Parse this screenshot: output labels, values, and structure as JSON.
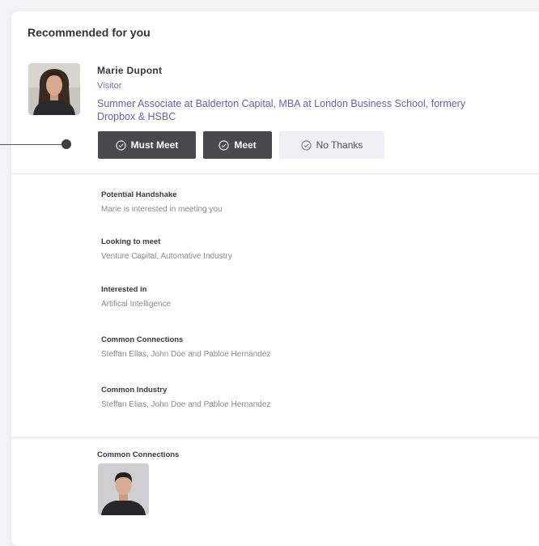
{
  "section": {
    "title": "Recommended for you"
  },
  "person": {
    "name": "Marie Dupont",
    "role": "Visitor",
    "headline": "Summer Associate at Balderton Capital, MBA at London Business School, formery Dropbox & HSBC"
  },
  "actions": {
    "must_meet_label": "Must Meet",
    "meet_label": "Meet",
    "no_thanks_label": "No Thanks"
  },
  "details": [
    {
      "label": "Potential Handshake",
      "value": "Marie is interested in meeting you"
    },
    {
      "label": "Looking to meet",
      "value": "Venture Capital, Automative Industry"
    },
    {
      "label": "Interested in",
      "value": "Artifical Intelligence"
    },
    {
      "label": "Common Connections",
      "value": "Steffan Ellas, John Doe and Pabloe Hernandez"
    },
    {
      "label": "Common Industry",
      "value": "Steffan Elias, John Doe and Pabloe Hernandez"
    }
  ],
  "common_connections": {
    "label": "Common Connections"
  },
  "colors": {
    "accent": "#6a5fb0",
    "button_dark": "#48484d",
    "button_light": "#efeff5"
  },
  "icons": {
    "action_icon": "check-circle-icon",
    "connector": "timeline-dot-icon"
  }
}
